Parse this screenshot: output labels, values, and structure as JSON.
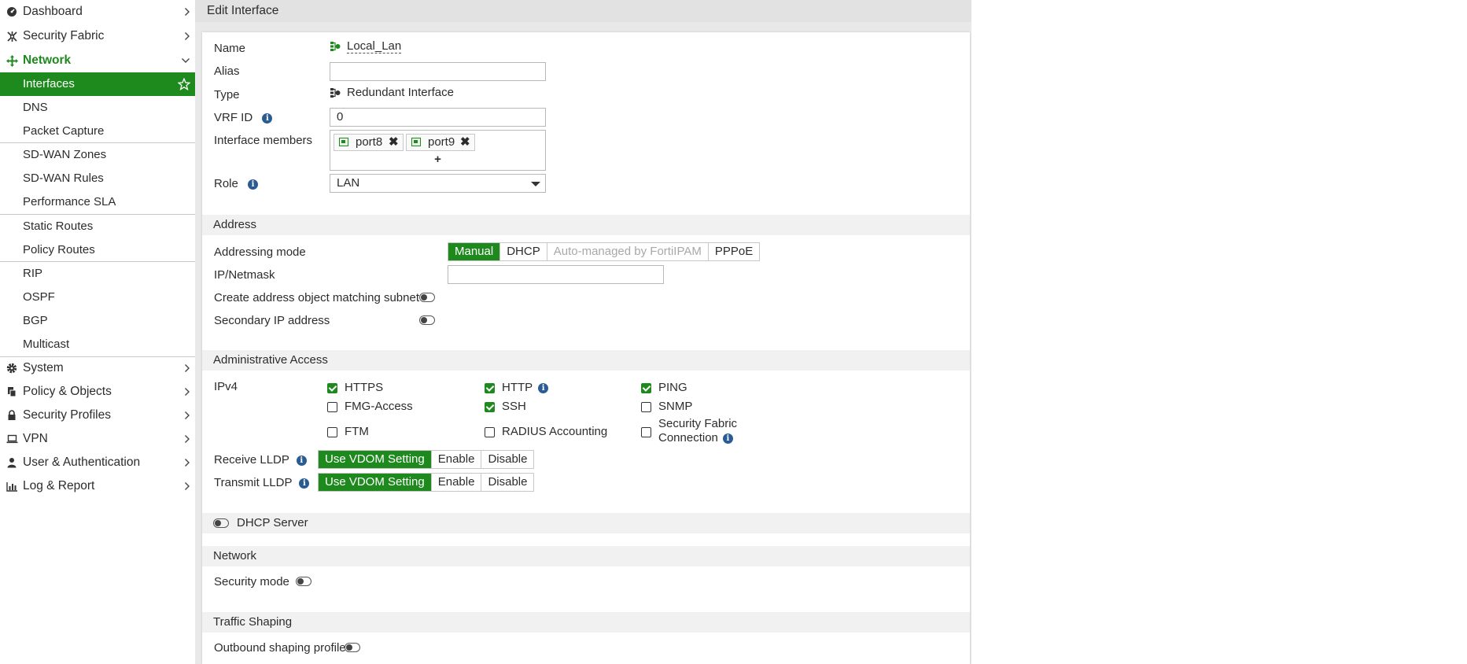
{
  "sidebar": {
    "items": [
      {
        "label": "Dashboard"
      },
      {
        "label": "Security Fabric"
      },
      {
        "label": "Network"
      },
      {
        "label": "Interfaces"
      },
      {
        "label": "DNS"
      },
      {
        "label": "Packet Capture"
      },
      {
        "label": "SD-WAN Zones"
      },
      {
        "label": "SD-WAN Rules"
      },
      {
        "label": "Performance SLA"
      },
      {
        "label": "Static Routes"
      },
      {
        "label": "Policy Routes"
      },
      {
        "label": "RIP"
      },
      {
        "label": "OSPF"
      },
      {
        "label": "BGP"
      },
      {
        "label": "Multicast"
      },
      {
        "label": "System"
      },
      {
        "label": "Policy & Objects"
      },
      {
        "label": "Security Profiles"
      },
      {
        "label": "VPN"
      },
      {
        "label": "User & Authentication"
      },
      {
        "label": "Log & Report"
      }
    ]
  },
  "page": {
    "title": "Edit Interface"
  },
  "form": {
    "name_label": "Name",
    "name_value": "Local_Lan",
    "alias_label": "Alias",
    "alias_value": "",
    "type_label": "Type",
    "type_value": "Redundant Interface",
    "vrf_label": "VRF ID",
    "vrf_value": "0",
    "members_label": "Interface members",
    "members": [
      "port8",
      "port9"
    ],
    "add_symbol": "+",
    "role_label": "Role",
    "role_value": "LAN"
  },
  "address": {
    "section": "Address",
    "mode_label": "Addressing mode",
    "modes": [
      "Manual",
      "DHCP",
      "Auto-managed by FortiIPAM",
      "PPPoE"
    ],
    "selected_mode": "Manual",
    "ipmask_label": "IP/Netmask",
    "ipmask_value": "",
    "create_obj_label": "Create address object matching subnet",
    "secondary_label": "Secondary IP address"
  },
  "admin": {
    "section": "Administrative Access",
    "ipv4_label": "IPv4",
    "checks": [
      {
        "label": "HTTPS",
        "checked": true
      },
      {
        "label": "HTTP",
        "checked": true
      },
      {
        "label": "PING",
        "checked": true
      },
      {
        "label": "FMG-Access",
        "checked": false
      },
      {
        "label": "SSH",
        "checked": true
      },
      {
        "label": "SNMP",
        "checked": false
      },
      {
        "label": "FTM",
        "checked": false
      },
      {
        "label": "RADIUS Accounting",
        "checked": false
      },
      {
        "label": "Security Fabric",
        "label2": "Connection",
        "checked": false
      }
    ],
    "receive_lldp_label": "Receive LLDP",
    "transmit_lldp_label": "Transmit LLDP",
    "lldp_options": [
      "Use VDOM Setting",
      "Enable",
      "Disable"
    ]
  },
  "dhcp": {
    "label": "DHCP Server"
  },
  "network": {
    "section": "Network",
    "security_mode_label": "Security mode"
  },
  "traffic": {
    "section": "Traffic Shaping",
    "outbound_label": "Outbound shaping profile"
  },
  "colors": {
    "accent": "#1e8a1e",
    "info": "#2a5c93"
  }
}
